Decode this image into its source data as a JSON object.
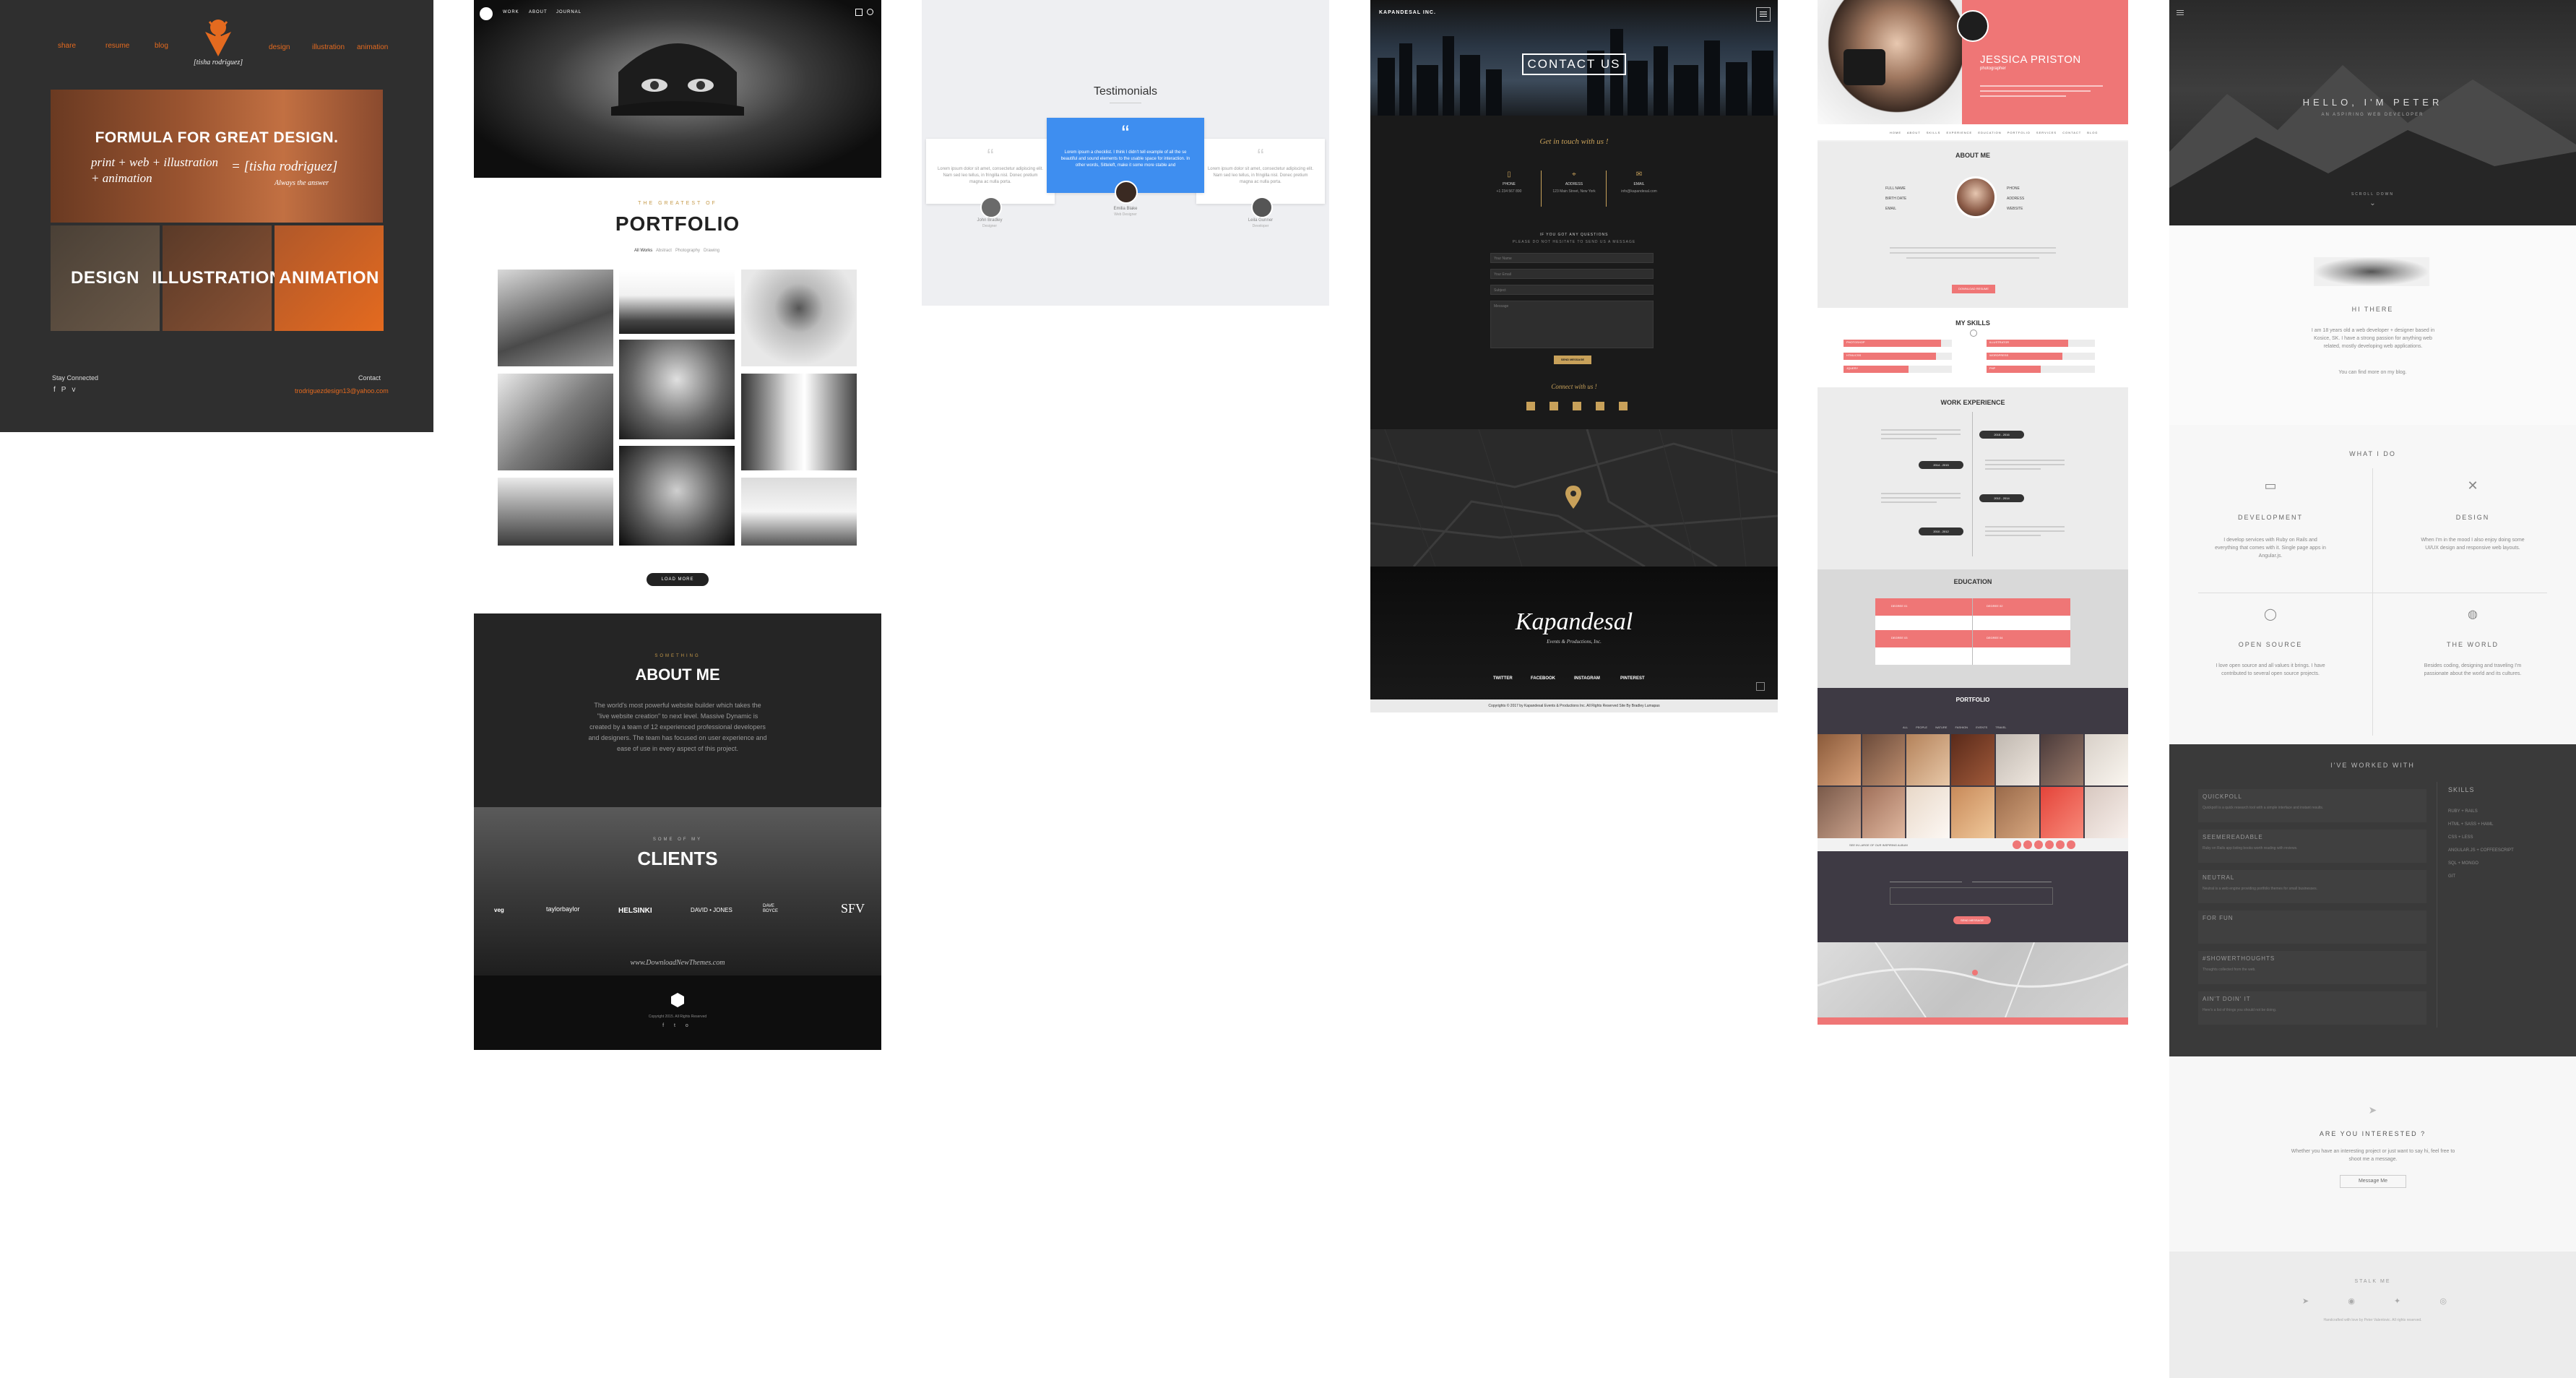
{
  "panel1": {
    "nav_left": [
      "share",
      "resume",
      "blog"
    ],
    "nav_right": [
      "design",
      "illustration",
      "animation"
    ],
    "logo_text": "[tisha rodriguez]",
    "hero_heading": "FORMULA FOR GREAT DESIGN.",
    "hero_formula": "print + web + illustration + animation",
    "hero_equals": "= [tisha rodriguez]",
    "hero_tagline": "Always the answer",
    "tiles": [
      "DESIGN",
      "ILLUSTRATION",
      "ANIMATION"
    ],
    "stay_connected": "Stay Connected",
    "contact": "Contact",
    "email": "trodriguezdesign13@yahoo.com",
    "accent": "#e46a1f"
  },
  "panel2": {
    "nav": [
      "WORK",
      "ABOUT",
      "JOURNAL"
    ],
    "portfolio_kicker": "THE GREATEST OF",
    "portfolio_title": "PORTFOLIO",
    "filters": [
      "All Works",
      "Abstract",
      "Photography",
      "Drawing"
    ],
    "load_more": "LOAD MORE",
    "about_kicker": "SOMETHING",
    "about_title": "ABOUT ME",
    "about_text": "The world's most powerful website builder which takes the \"live website creation\" to next level. Massive Dynamic is created by a team of 12 experienced professional developers and designers. The team has focused on user experience and ease of use in every aspect of this project.",
    "clients_kicker": "SOME OF MY",
    "clients_title": "CLIENTS",
    "clients": [
      "veg",
      "taylorbaylor",
      "HELSINKI",
      "DAVID • JONES",
      "DAVE BOYCE",
      "SFV"
    ],
    "watermark": "www.DownloadNewThemes.com",
    "copyright": "Copyright 2015. All Rights Reserved"
  },
  "panel3": {
    "title": "Testimonials",
    "cards": [
      {
        "text": "Lorem ipsum dolor sit amet, consectetur adipiscing elit. Nam sed leo tellus, in fringilla nisl. Donec pretium magna ac nulla porta.",
        "name": "John Bradley",
        "role": "Designer"
      },
      {
        "text": "Lorem ipsum a checklist. I think I didn't tell example of all the se beautiful and sound elements to the usable space for interaction. In other words, Sitteleft, make it some more stable and",
        "name": "Emilia Blake",
        "role": "Web Designer"
      },
      {
        "text": "Lorem ipsum dolor sit amet, consectetur adipiscing elit. Nam sed leo tellus, in fringilla nisl. Donec pretium magna ac nulla porta.",
        "name": "Leila Gunner",
        "role": "Developer"
      }
    ]
  },
  "panel4": {
    "brand": "KAPANDESAL INC.",
    "hero_title": "CONTACT US",
    "subtitle": "Get in touch with us !",
    "info": [
      {
        "label": "PHONE",
        "value": "+1 234 567 890"
      },
      {
        "label": "ADDRESS",
        "value": "123 Main Street, New York"
      },
      {
        "label": "EMAIL",
        "value": "info@kapandesal.com"
      }
    ],
    "question": "IF YOU GOT ANY QUESTIONS",
    "question_sub": "PLEASE DO NOT HESITATE TO SEND US A MESSAGE",
    "fields": [
      "Your Name",
      "Your Email",
      "Subject",
      "Message"
    ],
    "send": "SEND MESSAGE",
    "connect": "Connect with us !",
    "logo_script": "Kapandesal",
    "logo_sub": "Events & Productions, Inc.",
    "footer_links": [
      "TWITTER",
      "FACEBOOK",
      "INSTAGRAM",
      "PINTEREST"
    ],
    "copyright": "Copyrights © 2017 by Kapandesal Events & Productions Inc. All Rights Reserved Site By Bradley Lumapas",
    "accent": "#c8a15a"
  },
  "panel5": {
    "name": "JESSICA PRISTON",
    "role": "photographer",
    "nav": [
      "HOME",
      "ABOUT",
      "SKILLS",
      "EXPERIENCE",
      "EDUCATION",
      "PORTFOLIO",
      "SERVICES",
      "CONTACT",
      "BLOG"
    ],
    "about_title": "ABOUT ME",
    "about_fields": [
      {
        "k": "FULL NAME",
        "v": "Jessica Priston"
      },
      {
        "k": "BIRTH DATE",
        "v": "April 21, 1990"
      },
      {
        "k": "EMAIL",
        "v": "jessica@mail.com"
      },
      {
        "k": "PHONE",
        "v": "+1 234 567 890"
      },
      {
        "k": "ADDRESS",
        "v": "New York, USA"
      },
      {
        "k": "WEBSITE",
        "v": "www.priston.com"
      }
    ],
    "hire_button": "DOWNLOAD RESUME",
    "skills_title": "MY SKILLS",
    "skills": [
      {
        "name": "PHOTOSHOP",
        "value": 0.9
      },
      {
        "name": "ILLUSTRATOR",
        "value": 0.75
      },
      {
        "name": "HTML/CSS",
        "value": 0.85
      },
      {
        "name": "WORDPRESS",
        "value": 0.7
      },
      {
        "name": "JQUERY",
        "value": 0.6
      },
      {
        "name": "PHP",
        "value": 0.5
      }
    ],
    "experience_title": "WORK EXPERIENCE",
    "experience": [
      "2015 - 2016",
      "2014 - 2015",
      "2012 - 2014",
      "2010 - 2012"
    ],
    "education_title": "EDUCATION",
    "education_degrees": [
      "DEGREE 01",
      "DEGREE 02",
      "DEGREE 03",
      "DEGREE 04"
    ],
    "portfolio_title": "PORTFOLIO",
    "portfolio_filters": [
      "ALL",
      "PEOPLE",
      "NATURE",
      "FASHION",
      "EVENTS",
      "TRAVEL"
    ],
    "portfolio_cta": "SEE IN LARGE OF OUR INSPIRING ALBUM",
    "send": "SEND MESSAGE",
    "accent": "#ef7676"
  },
  "panel6": {
    "hero_title": "HELLO, I'M PETER",
    "hero_sub": "AN ASPIRING WEB DEVELOPER",
    "scroll": "SCROLL DOWN",
    "hi": "HI THERE",
    "bio": "I am 18 years old a web developer + designer based in Kosice, SK. I have a strong passion for anything web related, mostly developing web applications.",
    "blog_line": "You can find more on my blog.",
    "what": "WHAT I DO",
    "services": [
      {
        "title": "DEVELOPMENT",
        "text": "I develop services with Ruby on Rails and everything that comes with it. Single page apps in Angular.js."
      },
      {
        "title": "DESIGN",
        "text": "When I'm in the mood I also enjoy doing some UI/UX design and responsive web layouts."
      },
      {
        "title": "OPEN SOURCE",
        "text": "I love open source and all values it brings. I have contributed to several open source projects."
      },
      {
        "title": "THE WORLD",
        "text": "Besides coding, designing and traveling I'm passionate about the world and its cultures."
      }
    ],
    "worked_title": "I'VE WORKED WITH",
    "worked": [
      {
        "name": "QUICKPOLL",
        "text": "Quickpoll is a quick research tool with a simple interface and instant results."
      },
      {
        "name": "SEEMEREADABLE",
        "text": "Ruby on Rails app listing books worth reading with reviews."
      },
      {
        "name": "NEUTRAL",
        "text": "Neutral is a web engine providing portfolio themes for small businesses."
      },
      {
        "name": "FOR FUN",
        "text": ""
      },
      {
        "name": "#SHOWERTHOUGHTS",
        "text": "Thoughts collected from the web."
      },
      {
        "name": "AIN'T DOIN' IT",
        "text": "Here's a list of things you should not be doing."
      }
    ],
    "skills_title": "SKILLS",
    "skills": [
      "RUBY + RAILS",
      "HTML + SASS + HAML",
      "CSS + LESS",
      "ANGULAR.JS + COFFEESCRIPT",
      "SQL + MONGO",
      "GIT"
    ],
    "interested": "ARE YOU INTERESTED ?",
    "interested_text": "Whether you have an interesting project or just want to say hi, feel free to shoot me a message.",
    "message_button": "Message Me",
    "stalk": "STALK ME",
    "footer": "Handcrafted with love by Peter Valentovic. All rights reserved."
  }
}
